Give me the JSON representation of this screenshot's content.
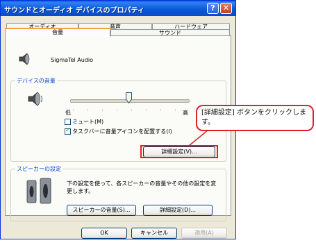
{
  "window": {
    "title": "サウンドとオーディオ デバイスのプロパティ",
    "help_label": "?",
    "close_label": "✕"
  },
  "tabs": {
    "row_back": [
      "オーディオ",
      "音声",
      "ハードウェア"
    ],
    "row_front": [
      "音量",
      "サウンド"
    ],
    "active": "音量"
  },
  "device": {
    "name": "SigmaTel Audio"
  },
  "device_volume": {
    "group_label": "デバイスの音量",
    "low_label": "低",
    "high_label": "高",
    "level_fraction": 0.5,
    "mute_label": "ミュート(M)",
    "mute_checked": false,
    "tray_icon_label": "タスクバーに音量アイコンを配置する(I)",
    "tray_icon_checked": true,
    "advanced_button": "詳細設定(V)..."
  },
  "speaker_settings": {
    "group_label": "スピーカーの設定",
    "description": "下の設定を使って、各スピーカーの音量やその他の設定を変更します。",
    "volume_button": "スピーカーの音量(S)...",
    "advanced_button": "詳細設定(D)..."
  },
  "dialog_buttons": {
    "ok": "OK",
    "cancel": "キャンセル",
    "apply": "適用(A)"
  },
  "callout": {
    "text": "[詳細設定] ボタンをクリックします。"
  },
  "colors": {
    "highlight": "#e02020",
    "group_label": "#0046d5",
    "titlebar": "#0b59d8"
  }
}
